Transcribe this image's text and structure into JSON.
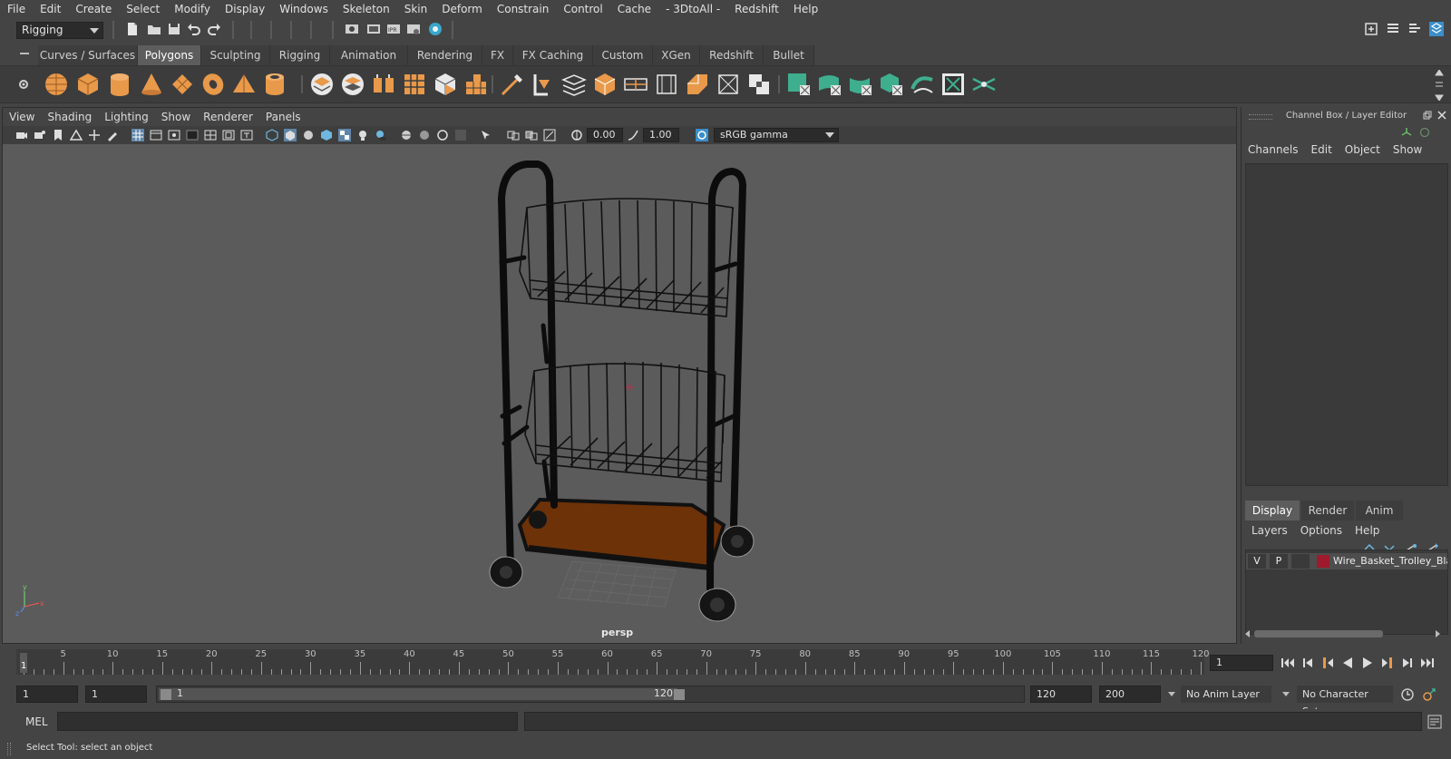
{
  "menubar": {
    "items": [
      "File",
      "Edit",
      "Create",
      "Select",
      "Modify",
      "Display",
      "Windows",
      "Skeleton",
      "Skin",
      "Deform",
      "Constrain",
      "Control",
      "Cache",
      "- 3DtoAll -",
      "Redshift",
      "Help"
    ]
  },
  "statusline": {
    "mode": "Rigging"
  },
  "shelf": {
    "tabs": [
      "Curves / Surfaces",
      "Polygons",
      "Sculpting",
      "Rigging",
      "Animation",
      "Rendering",
      "FX",
      "FX Caching",
      "Custom",
      "XGen",
      "Redshift",
      "Bullet"
    ],
    "active_tab": "Polygons"
  },
  "viewport": {
    "menu": [
      "View",
      "Shading",
      "Lighting",
      "Show",
      "Renderer",
      "Panels"
    ],
    "exposure": "0.00",
    "gamma": "1.00",
    "color_space": "sRGB gamma",
    "camera_label": "persp",
    "axis_labels": {
      "x": "x",
      "y": "y",
      "z": "z"
    }
  },
  "channel_box": {
    "title": "Channel Box / Layer Editor",
    "menu": [
      "Channels",
      "Edit",
      "Object",
      "Show"
    ]
  },
  "layer_editor": {
    "tabs": [
      "Display",
      "Render",
      "Anim"
    ],
    "active_tab": "Display",
    "menu": [
      "Layers",
      "Options",
      "Help"
    ],
    "layers": [
      {
        "visible": "V",
        "playback": "P",
        "color": "#9e1a2c",
        "name": "Wire_Basket_Trolley_Black"
      }
    ]
  },
  "timeline": {
    "ticks": [
      "5",
      "10",
      "15",
      "20",
      "25",
      "30",
      "35",
      "40",
      "45",
      "50",
      "55",
      "60",
      "65",
      "70",
      "75",
      "80",
      "85",
      "90",
      "95",
      "100",
      "105",
      "110",
      "115",
      "120"
    ],
    "current_frame_marker": "1",
    "current_frame": "1"
  },
  "range": {
    "start": "1",
    "playback_start": "1",
    "slider_start": "1",
    "slider_end": "120",
    "playback_end": "120",
    "end": "200",
    "anim_layer": "No Anim Layer",
    "character_set": "No Character Set"
  },
  "command_line": {
    "language": "MEL"
  },
  "help_line": {
    "text": "Select Tool: select an object"
  },
  "colors": {
    "accent_teal": "#3fae8f",
    "shelf_orange": "#e8994a",
    "layer_red": "#9e1a2c",
    "wood": "#6e3208"
  }
}
